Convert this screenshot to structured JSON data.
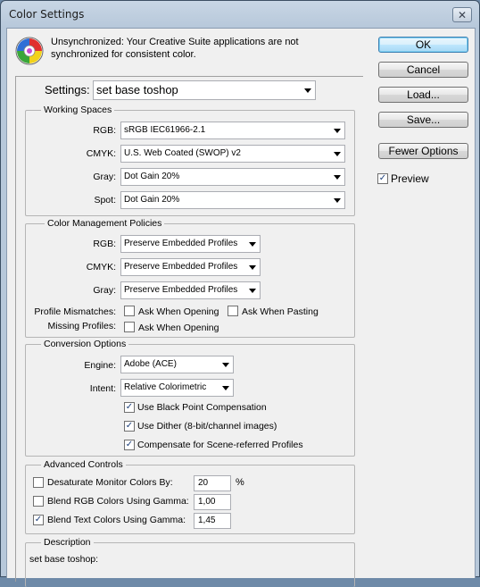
{
  "window": {
    "title": "Color Settings",
    "close_glyph": "✕"
  },
  "message": {
    "icon": "color-wheel-icon",
    "text": "Unsynchronized: Your Creative Suite applications are not synchronized for consistent color."
  },
  "buttons": {
    "ok": "OK",
    "cancel": "Cancel",
    "load": "Load...",
    "save": "Save...",
    "fewer_options": "Fewer Options"
  },
  "preview": {
    "label": "Preview",
    "checked": true
  },
  "settings": {
    "label": "Settings:",
    "value": "set base toshop"
  },
  "working_spaces": {
    "title": "Working Spaces",
    "rgb_label": "RGB:",
    "rgb_value": "sRGB IEC61966-2.1",
    "cmyk_label": "CMYK:",
    "cmyk_value": "U.S. Web Coated (SWOP) v2",
    "gray_label": "Gray:",
    "gray_value": "Dot Gain 20%",
    "spot_label": "Spot:",
    "spot_value": "Dot Gain 20%"
  },
  "cmp": {
    "title": "Color Management Policies",
    "rgb_label": "RGB:",
    "rgb_value": "Preserve Embedded Profiles",
    "cmyk_label": "CMYK:",
    "cmyk_value": "Preserve Embedded Profiles",
    "gray_label": "Gray:",
    "gray_value": "Preserve Embedded Profiles",
    "mismatch_label": "Profile Mismatches:",
    "ask_opening": "Ask When Opening",
    "ask_opening_checked": false,
    "ask_pasting": "Ask When Pasting",
    "ask_pasting_checked": false,
    "missing_label": "Missing Profiles:",
    "missing_ask_opening": "Ask When Opening",
    "missing_ask_opening_checked": false
  },
  "conversion": {
    "title": "Conversion Options",
    "engine_label": "Engine:",
    "engine_value": "Adobe (ACE)",
    "intent_label": "Intent:",
    "intent_value": "Relative Colorimetric",
    "bpc": "Use Black Point Compensation",
    "bpc_checked": true,
    "dither": "Use Dither (8-bit/channel images)",
    "dither_checked": true,
    "scene": "Compensate for Scene-referred Profiles",
    "scene_checked": true
  },
  "advanced": {
    "title": "Advanced Controls",
    "desaturate": "Desaturate Monitor Colors By:",
    "desaturate_checked": false,
    "desaturate_value": "20",
    "desaturate_unit": "%",
    "blend_rgb": "Blend RGB Colors Using Gamma:",
    "blend_rgb_checked": false,
    "blend_rgb_value": "1,00",
    "blend_text": "Blend Text Colors Using Gamma:",
    "blend_text_checked": true,
    "blend_text_value": "1,45"
  },
  "description": {
    "title": "Description",
    "text": "set base toshop:"
  }
}
